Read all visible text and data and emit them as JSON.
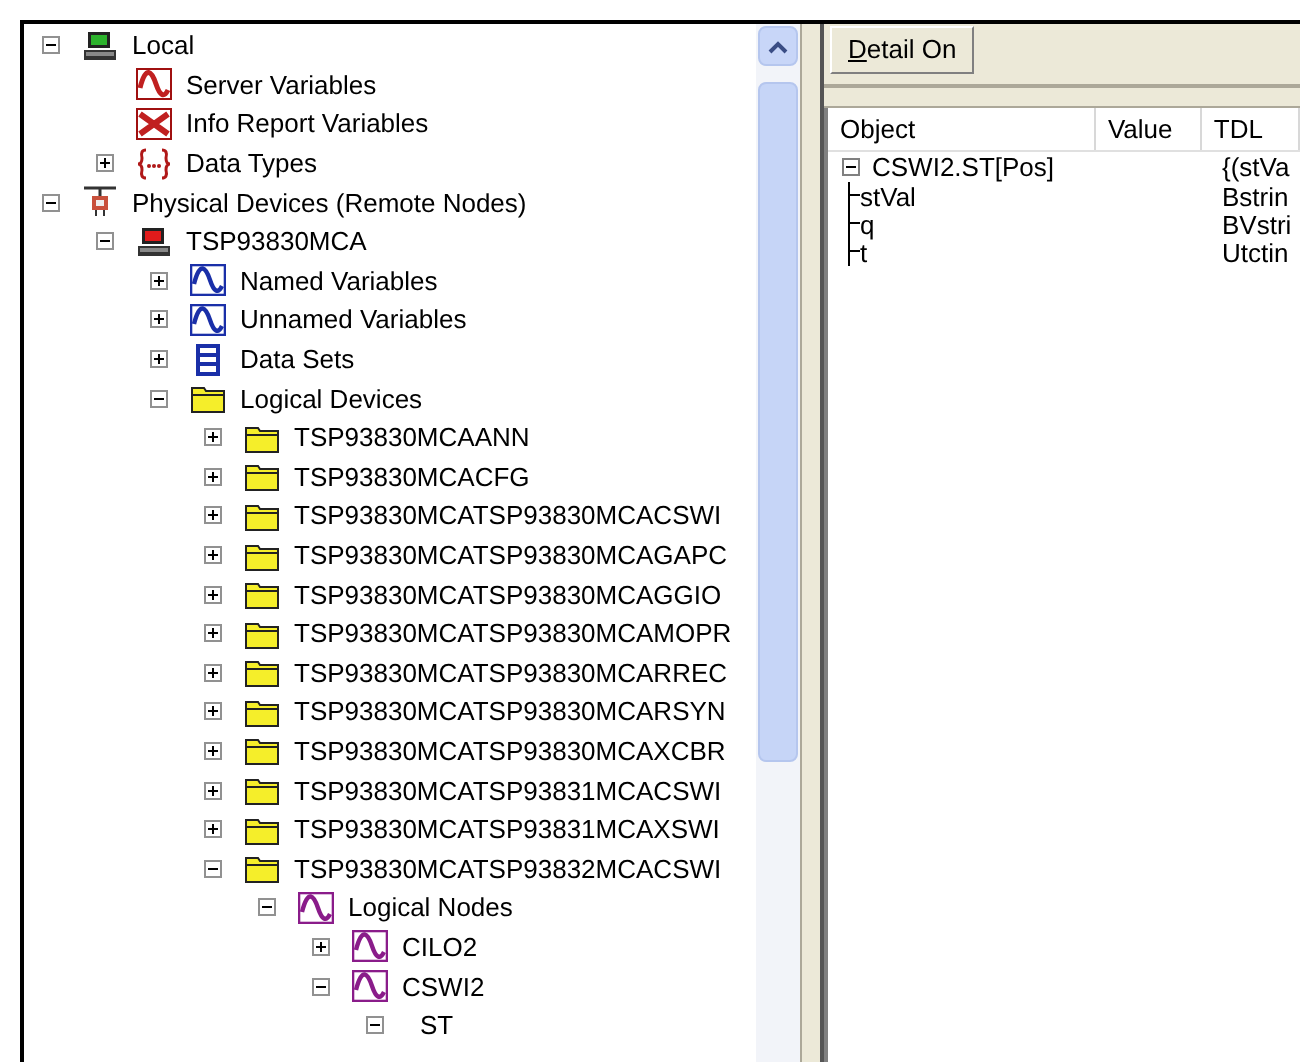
{
  "tree": [
    {
      "label": "Local",
      "kind": "local",
      "expanded": true,
      "children": [
        {
          "label": "Server Variables",
          "kind": "variables"
        },
        {
          "label": "Info Report Variables",
          "kind": "report"
        },
        {
          "label": "Data Types",
          "kind": "types",
          "expanded": false
        }
      ]
    },
    {
      "label": "Physical Devices (Remote Nodes)",
      "kind": "network",
      "expanded": true,
      "children": [
        {
          "label": "TSP93830MCA",
          "kind": "device",
          "expanded": true,
          "children": [
            {
              "label": "Named Variables",
              "kind": "named",
              "expanded": false
            },
            {
              "label": "Unnamed Variables",
              "kind": "named",
              "expanded": false
            },
            {
              "label": "Data Sets",
              "kind": "datasets",
              "expanded": false
            },
            {
              "label": "Logical Devices",
              "kind": "folder",
              "expanded": true,
              "children": [
                {
                  "label": "TSP93830MCAANN",
                  "kind": "folder",
                  "expanded": false
                },
                {
                  "label": "TSP93830MCACFG",
                  "kind": "folder",
                  "expanded": false
                },
                {
                  "label": "TSP93830MCATSP93830MCACSWI",
                  "kind": "folder",
                  "expanded": false
                },
                {
                  "label": "TSP93830MCATSP93830MCAGAPC",
                  "kind": "folder",
                  "expanded": false
                },
                {
                  "label": "TSP93830MCATSP93830MCAGGIO",
                  "kind": "folder",
                  "expanded": false
                },
                {
                  "label": "TSP93830MCATSP93830MCAMOPR",
                  "kind": "folder",
                  "expanded": false
                },
                {
                  "label": "TSP93830MCATSP93830MCARREC",
                  "kind": "folder",
                  "expanded": false
                },
                {
                  "label": "TSP93830MCATSP93830MCARSYN",
                  "kind": "folder",
                  "expanded": false
                },
                {
                  "label": "TSP93830MCATSP93830MCAXCBR",
                  "kind": "folder",
                  "expanded": false
                },
                {
                  "label": "TSP93830MCATSP93831MCACSWI",
                  "kind": "folder",
                  "expanded": false
                },
                {
                  "label": "TSP93830MCATSP93831MCAXSWI",
                  "kind": "folder",
                  "expanded": false
                },
                {
                  "label": "TSP93830MCATSP93832MCACSWI",
                  "kind": "folder",
                  "expanded": true,
                  "children": [
                    {
                      "label": "Logical Nodes",
                      "kind": "nodes",
                      "expanded": true,
                      "children": [
                        {
                          "label": "CILO2",
                          "kind": "nodes",
                          "expanded": false
                        },
                        {
                          "label": "CSWI2",
                          "kind": "nodes",
                          "expanded": true,
                          "children": [
                            {
                              "label": "ST",
                              "expanded": true
                            }
                          ]
                        }
                      ]
                    }
                  ]
                }
              ]
            }
          ]
        }
      ]
    }
  ],
  "toolbar": {
    "button": "Detail On"
  },
  "table": {
    "columns": [
      "Object",
      "Value",
      "TDL"
    ],
    "rows": [
      {
        "object": "CSWI2.ST[Pos]",
        "expanded": true,
        "tdl": "{(stVa",
        "children": [
          {
            "object": "stVal",
            "tdl": "Bstrin"
          },
          {
            "object": "q",
            "tdl": "BVstri"
          },
          {
            "object": "t",
            "tdl": "Utctin"
          }
        ]
      }
    ]
  }
}
